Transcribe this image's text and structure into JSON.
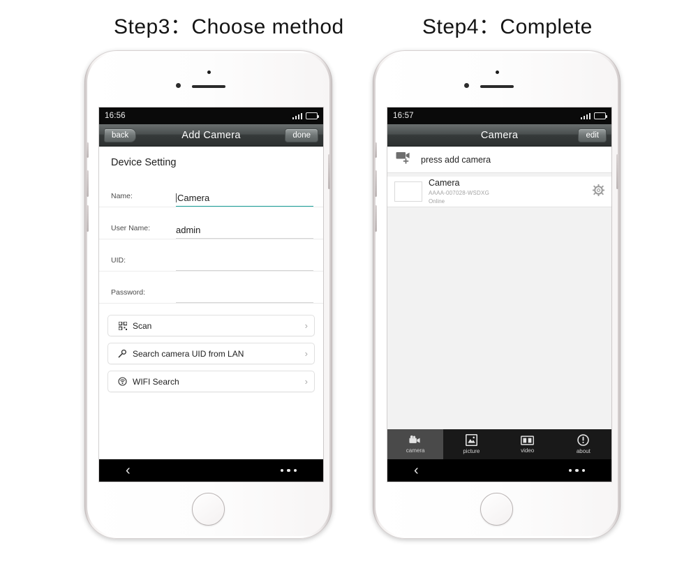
{
  "titles": {
    "left": "Step3：Choose method",
    "right": "Step4：Complete"
  },
  "left_phone": {
    "status": {
      "time": "16:56",
      "signal_icon": "signal-bars-icon",
      "battery_icon": "battery-icon"
    },
    "navbar": {
      "back_label": "back",
      "title": "Add Camera",
      "done_label": "done"
    },
    "form": {
      "section_title": "Device Setting",
      "fields": [
        {
          "label": "Name:",
          "value": "Camera",
          "placeholder": "",
          "focused": true
        },
        {
          "label": "User Name:",
          "value": "admin",
          "placeholder": "",
          "focused": false
        },
        {
          "label": "UID:",
          "value": "",
          "placeholder": "",
          "focused": false
        },
        {
          "label": "Password:",
          "value": "",
          "placeholder": "",
          "focused": false
        }
      ]
    },
    "actions": [
      {
        "label": "Scan",
        "icon": "qr-scan-icon",
        "chevron": "›"
      },
      {
        "label": "Search camera UID from LAN",
        "icon": "search-icon",
        "chevron": "›"
      },
      {
        "label": "WIFI Search",
        "icon": "wifi-icon",
        "chevron": "›"
      }
    ],
    "softkeys": {
      "back": "‹",
      "menu": "menu-dots-icon"
    }
  },
  "right_phone": {
    "status": {
      "time": "16:57",
      "signal_icon": "signal-bars-icon",
      "battery_icon": "battery-icon"
    },
    "navbar": {
      "title": "Camera",
      "edit_label": "edit"
    },
    "add_row": {
      "label": "press add camera",
      "icon": "add-camera-icon"
    },
    "camera": {
      "name": "Camera",
      "uid": "AAAA-007028-WSDXG",
      "status": "Online",
      "settings_icon": "gear-icon",
      "thumbnail": "camera-snapshot-thumbnail"
    },
    "tabs": [
      {
        "label": "camera",
        "icon": "camera-icon",
        "active": true
      },
      {
        "label": "picture",
        "icon": "picture-icon",
        "active": false
      },
      {
        "label": "video",
        "icon": "video-icon",
        "active": false
      },
      {
        "label": "about",
        "icon": "info-icon",
        "active": false
      }
    ],
    "softkeys": {
      "back": "‹",
      "menu": "menu-dots-icon"
    }
  },
  "colors": {
    "accent_focus": "#18a09a",
    "navbar_dark": "#363a3a",
    "tabbar_bg": "#191919",
    "tab_active_bg": "#4a4a4a"
  }
}
